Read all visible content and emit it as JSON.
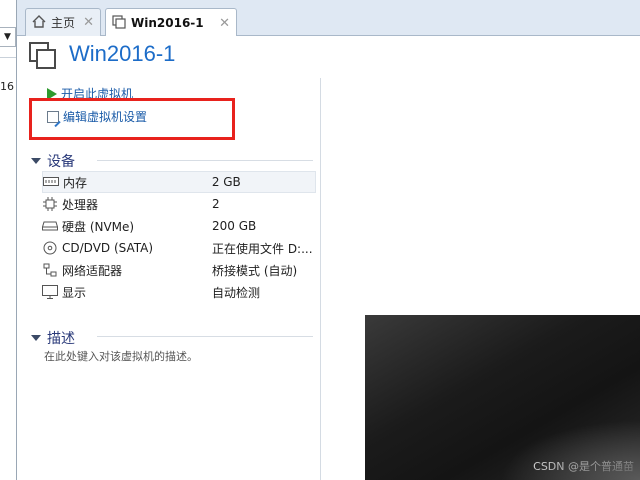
{
  "library": {
    "partial_number": "16"
  },
  "tabs": [
    {
      "label": "主页",
      "icon": "home-icon",
      "close": "✕"
    },
    {
      "label": "Win2016-1",
      "icon": "vm-tab-icon",
      "close": "✕"
    }
  ],
  "vm": {
    "title": "Win2016-1"
  },
  "actions": {
    "power_on": "开启此虚拟机",
    "edit_settings": "编辑虚拟机设置"
  },
  "devices_section": {
    "title": "设备"
  },
  "devices": [
    {
      "name": "内存",
      "value": "2 GB",
      "icon": "memory-icon"
    },
    {
      "name": "处理器",
      "value": "2",
      "icon": "cpu-icon"
    },
    {
      "name": "硬盘 (NVMe)",
      "value": "200 GB",
      "icon": "hard-disk-icon"
    },
    {
      "name": "CD/DVD (SATA)",
      "value": "正在使用文件 D:...",
      "icon": "cd-dvd-icon"
    },
    {
      "name": "网络适配器",
      "value": "桥接模式 (自动)",
      "icon": "network-adapter-icon"
    },
    {
      "name": "显示",
      "value": "自动检测",
      "icon": "display-icon"
    }
  ],
  "description_section": {
    "title": "描述",
    "placeholder": "在此处键入对该虚拟机的描述。"
  },
  "watermark": "CSDN @是个普通苗",
  "colors": {
    "accent": "#1c6cc8",
    "link": "#1a5ba8",
    "highlight_box": "#e8221d",
    "play": "#2e9a2e"
  }
}
